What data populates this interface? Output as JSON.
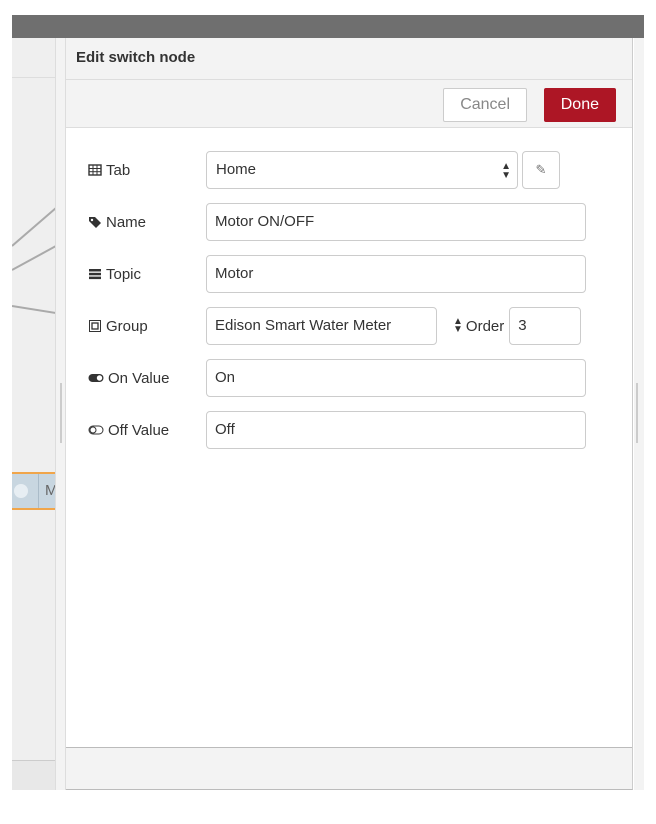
{
  "dialog": {
    "title": "Edit switch node",
    "cancel_label": "Cancel",
    "done_label": "Done",
    "accent": "#ad1625"
  },
  "canvas": {
    "node_label": "M"
  },
  "form": {
    "tab": {
      "label": "Tab",
      "value": "Home",
      "icon": "table-icon"
    },
    "name": {
      "label": "Name",
      "value": "Motor ON/OFF",
      "icon": "tag-icon"
    },
    "topic": {
      "label": "Topic",
      "value": "Motor",
      "icon": "tasks-icon"
    },
    "group": {
      "label": "Group",
      "value": "Edison Smart Water Meter",
      "icon": "object-group-icon"
    },
    "order": {
      "label": "Order",
      "value": "3",
      "icon": "sort-icon"
    },
    "on_value": {
      "label": "On Value",
      "value": "On",
      "icon": "toggle-on-icon"
    },
    "off_value": {
      "label": "Off Value",
      "value": "Off",
      "icon": "toggle-off-icon"
    }
  }
}
